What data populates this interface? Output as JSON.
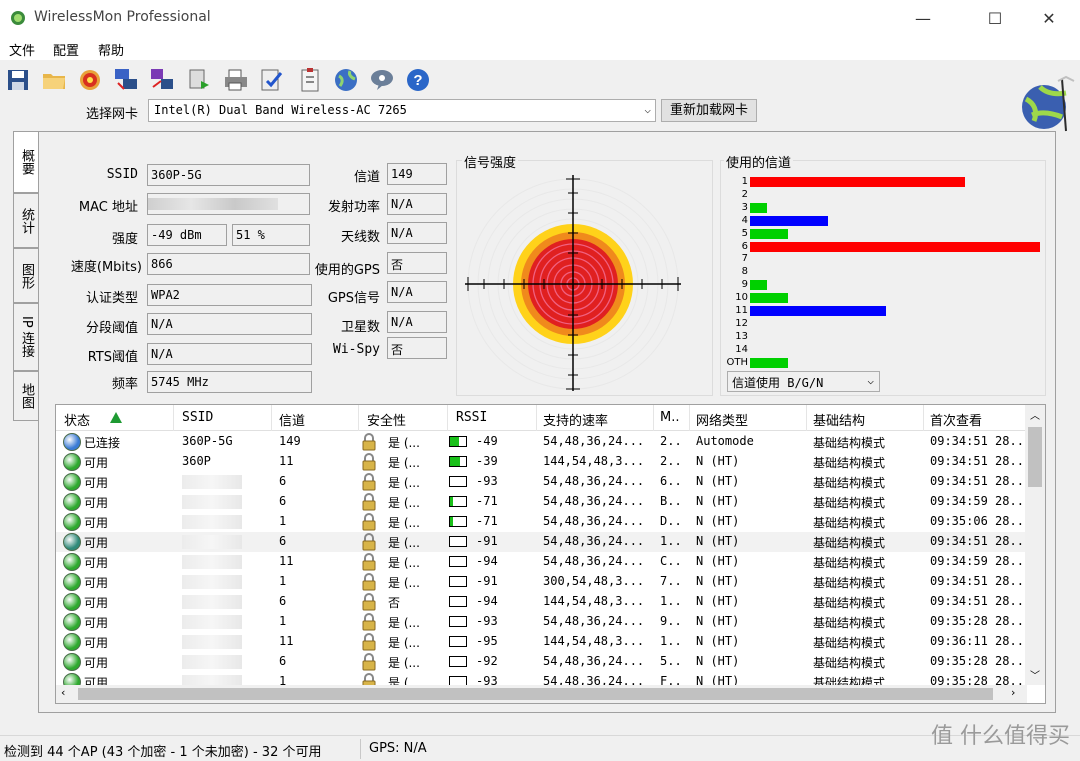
{
  "window": {
    "title": "WirelessMon Professional",
    "min": "—",
    "max": "☐",
    "close": "✕"
  },
  "menu": [
    "文件",
    "配置",
    "帮助"
  ],
  "toolbar": {
    "icons": [
      "save-icon",
      "open-folder-icon",
      "target-icon",
      "network-icon",
      "network-map-icon",
      "export-icon",
      "print-icon",
      "check-icon",
      "clipboard-icon",
      "globe-icon",
      "chat-icon",
      "help-icon"
    ]
  },
  "nic": {
    "label": "选择网卡",
    "selected": "Intel(R) Dual Band Wireless-AC 7265",
    "reload": "重新加载网卡"
  },
  "tabs": [
    "概要",
    "统计",
    "图形",
    "IP 连接",
    "地图"
  ],
  "summary": {
    "ssid_label": "SSID",
    "ssid": "360P-5G",
    "mac_label": "MAC 地址",
    "mac": "",
    "strength_label": "强度",
    "strength_dbm": "-49 dBm",
    "strength_pct": "51 %",
    "speed_label": "速度(Mbits)",
    "speed": "866",
    "auth_label": "认证类型",
    "auth": "WPA2",
    "frag_label": "分段阈值",
    "frag": "N/A",
    "rts_label": "RTS阈值",
    "rts": "N/A",
    "freq_label": "频率",
    "freq": "5745 MHz",
    "channel_label": "信道",
    "channel": "149",
    "txpower_label": "发射功率",
    "txpower": "N/A",
    "antenna_label": "天线数",
    "antenna": "N/A",
    "gps_used_label": "使用的GPS",
    "gps_used": "否",
    "gps_signal_label": "GPS信号",
    "gps_signal": "N/A",
    "sat_label": "卫星数",
    "sat": "N/A",
    "wispy_label": "Wi-Spy",
    "wispy": "否"
  },
  "signal": {
    "title": "信号强度"
  },
  "channels": {
    "title": "使用的信道",
    "select": "信道使用 B/G/N",
    "labels": [
      "1",
      "2",
      "3",
      "4",
      "5",
      "6",
      "7",
      "8",
      "9",
      "10",
      "11",
      "12",
      "13",
      "14",
      "OTH"
    ],
    "bars": [
      {
        "ch": "1",
        "color": "#ff0000",
        "value": 0.74
      },
      {
        "ch": "3",
        "color": "#00d000",
        "value": 0.06
      },
      {
        "ch": "4",
        "color": "#0000ff",
        "value": 0.27
      },
      {
        "ch": "5",
        "color": "#00d000",
        "value": 0.13
      },
      {
        "ch": "6",
        "color": "#ff0000",
        "value": 1.0
      },
      {
        "ch": "9",
        "color": "#00d000",
        "value": 0.06
      },
      {
        "ch": "10",
        "color": "#00d000",
        "value": 0.13
      },
      {
        "ch": "11",
        "color": "#0000ff",
        "value": 0.47
      },
      {
        "ch": "OTH",
        "color": "#00d000",
        "value": 0.13
      }
    ]
  },
  "table": {
    "headers": [
      "状态",
      "SSID",
      "信道",
      "安全性",
      "RSSI",
      "支持的速率",
      "M..",
      "网络类型",
      "基础结构",
      "首次查看"
    ],
    "rows": [
      {
        "status": "已连接",
        "dot": "#3a7bd5",
        "ssid": "360P-5G",
        "ch": "149",
        "sec": "是 (...",
        "rssi": "-49",
        "fill": 0.55,
        "rates": "54,48,36,24...",
        "m": "2..",
        "net": "Automode",
        "infra": "基础结构模式",
        "first": "09:34:51 28.."
      },
      {
        "status": "可用",
        "dot": "#2fa92f",
        "ssid": "360P",
        "ch": "11",
        "sec": "是 (...",
        "rssi": "-39",
        "fill": 0.6,
        "rates": "144,54,48,3...",
        "m": "2..",
        "net": "N (HT)",
        "infra": "基础结构模式",
        "first": "09:34:51 28.."
      },
      {
        "status": "可用",
        "dot": "#2fa92f",
        "ssid": "",
        "ch": "6",
        "sec": "是 (...",
        "rssi": "-93",
        "fill": 0,
        "rates": "54,48,36,24...",
        "m": "6..",
        "net": "N (HT)",
        "infra": "基础结构模式",
        "first": "09:34:51 28.."
      },
      {
        "status": "可用",
        "dot": "#2fa92f",
        "ssid": "",
        "ch": "6",
        "sec": "是 (...",
        "rssi": "-71",
        "fill": 0.2,
        "rates": "54,48,36,24...",
        "m": "B..",
        "net": "N (HT)",
        "infra": "基础结构模式",
        "first": "09:34:59 28.."
      },
      {
        "status": "可用",
        "dot": "#2fa92f",
        "ssid": "",
        "ch": "1",
        "sec": "是 (...",
        "rssi": "-71",
        "fill": 0.2,
        "rates": "54,48,36,24...",
        "m": "D..",
        "net": "N (HT)",
        "infra": "基础结构模式",
        "first": "09:35:06 28.."
      },
      {
        "status": "可用",
        "dot": "#2f8a7a",
        "ssid": "",
        "ch": "6",
        "sec": "是 (...",
        "rssi": "-91",
        "fill": 0,
        "rates": "54,48,36,24...",
        "m": "1..",
        "net": "N (HT)",
        "infra": "基础结构模式",
        "first": "09:34:51 28.."
      },
      {
        "status": "可用",
        "dot": "#2fa92f",
        "ssid": "",
        "ch": "11",
        "sec": "是 (...",
        "rssi": "-94",
        "fill": 0,
        "rates": "54,48,36,24...",
        "m": "C..",
        "net": "N (HT)",
        "infra": "基础结构模式",
        "first": "09:34:59 28.."
      },
      {
        "status": "可用",
        "dot": "#2fa92f",
        "ssid": "",
        "ch": "1",
        "sec": "是 (...",
        "rssi": "-91",
        "fill": 0,
        "rates": "300,54,48,3...",
        "m": "7..",
        "net": "N (HT)",
        "infra": "基础结构模式",
        "first": "09:34:51 28.."
      },
      {
        "status": "可用",
        "dot": "#2fa92f",
        "ssid": "",
        "ch": "6",
        "sec": "否",
        "rssi": "-94",
        "fill": 0,
        "rates": "144,54,48,3...",
        "m": "1..",
        "net": "N (HT)",
        "infra": "基础结构模式",
        "first": "09:34:51 28.."
      },
      {
        "status": "可用",
        "dot": "#2fa92f",
        "ssid": "",
        "ch": "1",
        "sec": "是 (...",
        "rssi": "-93",
        "fill": 0,
        "rates": "54,48,36,24...",
        "m": "9..",
        "net": "N (HT)",
        "infra": "基础结构模式",
        "first": "09:35:28 28.."
      },
      {
        "status": "可用",
        "dot": "#2fa92f",
        "ssid": "",
        "ch": "11",
        "sec": "是 (...",
        "rssi": "-95",
        "fill": 0,
        "rates": "144,54,48,3...",
        "m": "1..",
        "net": "N (HT)",
        "infra": "基础结构模式",
        "first": "09:36:11 28.."
      },
      {
        "status": "可用",
        "dot": "#2fa92f",
        "ssid": "",
        "ch": "6",
        "sec": "是 (...",
        "rssi": "-92",
        "fill": 0,
        "rates": "54,48,36,24...",
        "m": "5..",
        "net": "N (HT)",
        "infra": "基础结构模式",
        "first": "09:35:28 28.."
      },
      {
        "status": "可用",
        "dot": "#2fa92f",
        "ssid": "",
        "ch": "1",
        "sec": "是 (...",
        "rssi": "-93",
        "fill": 0,
        "rates": "54,48,36,24...",
        "m": "F..",
        "net": "N (HT)",
        "infra": "基础结构模式",
        "first": "09:35:28 28.."
      }
    ]
  },
  "statusbar": {
    "ap_summary": "检测到 44 个AP (43 个加密 - 1 个未加密) - 32 个可用",
    "gps": "GPS: N/A"
  },
  "watermark": "值 什么值得买"
}
